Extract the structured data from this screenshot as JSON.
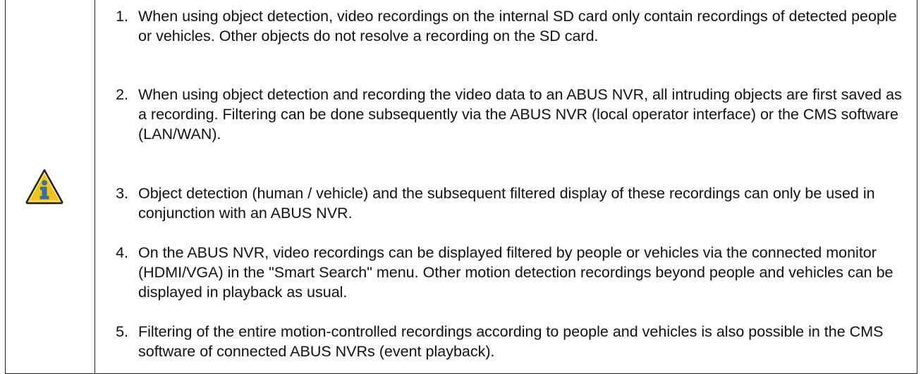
{
  "notes": [
    {
      "number": "1.",
      "text": "When using object detection, video recordings on the internal SD card only contain recordings of detected people or vehicles. Other objects do not resolve a recording on the SD card."
    },
    {
      "number": "2.",
      "text": "When using object detection and recording the video data to an ABUS NVR, all intruding objects are first saved as a recording. Filtering can be done subsequently via the ABUS NVR (local operator interface) or the CMS software (LAN/WAN)."
    },
    {
      "number": "3.",
      "text": "Object detection (human / vehicle) and the subsequent filtered display of these recordings can only be used in conjunction with an ABUS NVR."
    },
    {
      "number": "4.",
      "text": "On the ABUS NVR, video recordings can be displayed filtered by people or vehicles via the connected monitor (HDMI/VGA) in the \"Smart Search\" menu. Other motion detection recordings beyond people and vehicles can be displayed in playback as usual."
    },
    {
      "number": "5.",
      "text": "Filtering of the entire motion-controlled recordings according to people and vehicles is also possible in the CMS software of connected ABUS NVRs (event playback)."
    }
  ],
  "icon": {
    "name": "info-warning-icon",
    "fill": "#F2C41A",
    "letter_color": "#2F73B8"
  }
}
